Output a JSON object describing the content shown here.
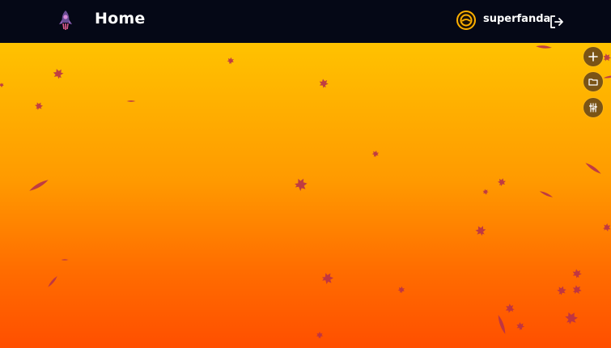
{
  "header": {
    "title": "Home",
    "username": "superfanda",
    "logo_icon": "rocket-icon",
    "avatar_icon": "user-avatar",
    "logout_icon": "logout-icon"
  },
  "actions": [
    {
      "name": "add",
      "icon": "plus-icon"
    },
    {
      "name": "folder",
      "icon": "folder-icon"
    },
    {
      "name": "settings",
      "icon": "sliders-icon"
    }
  ],
  "background": {
    "decoration": "falling-leaves",
    "colors": {
      "navbar": "#050816",
      "gradient_top": "#ffc200",
      "gradient_bottom": "#ff4f00",
      "leaf": "#b8324a",
      "action_button": "#7a5416",
      "avatar_ring": "#ffb000"
    }
  }
}
